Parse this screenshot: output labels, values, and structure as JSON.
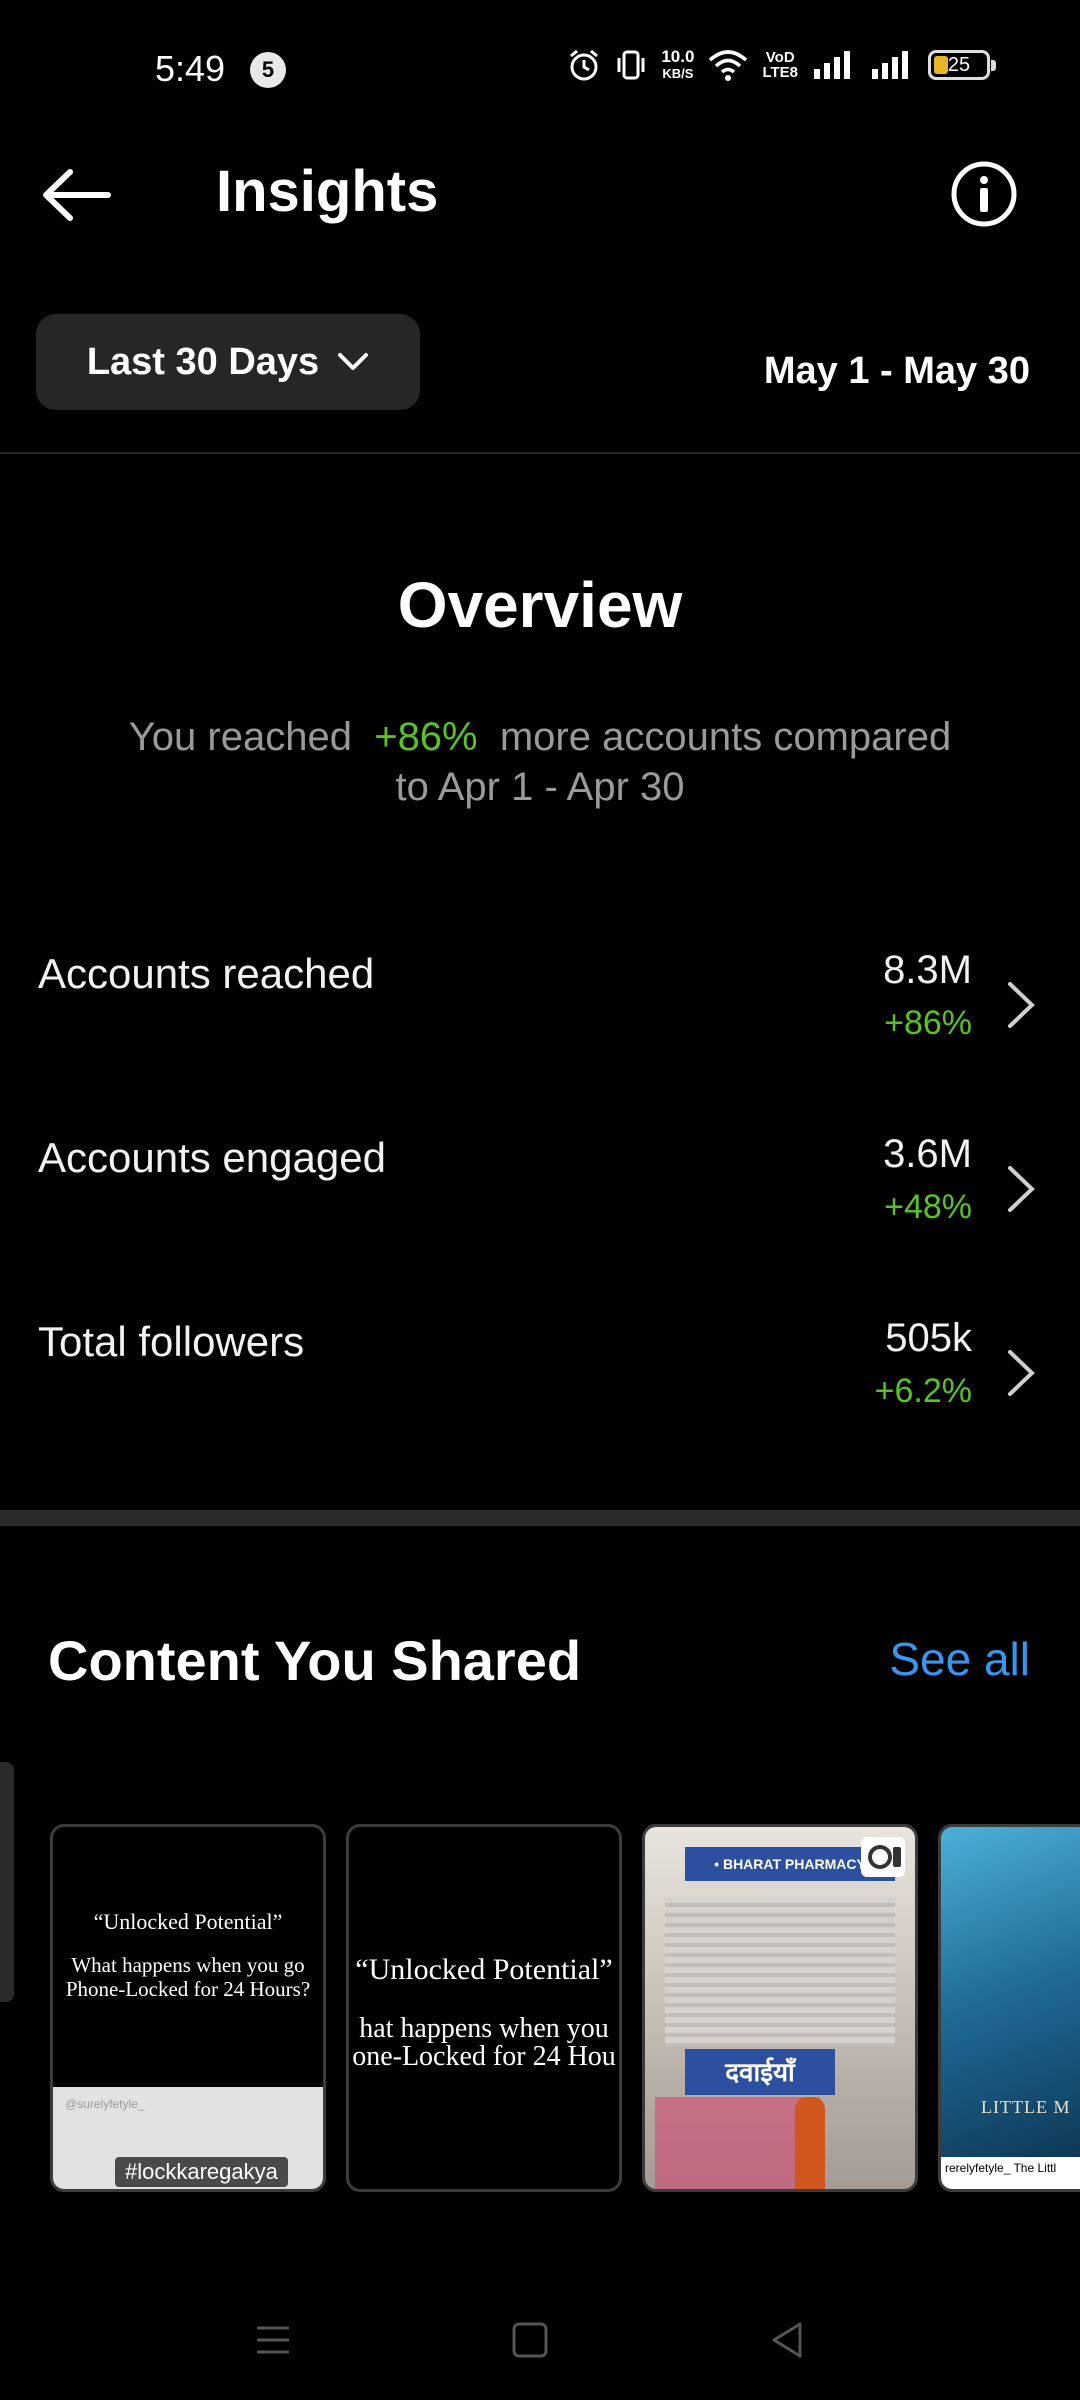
{
  "status_bar": {
    "time": "5:49",
    "notification_count": "5",
    "net_speed_value": "10.0",
    "net_speed_unit": "KB/S",
    "volte_top": "VoD",
    "volte_bottom": "LTE8",
    "battery_level": "25"
  },
  "header": {
    "title": "Insights"
  },
  "filter": {
    "range_label": "Last 30 Days",
    "date_range": "May 1 - May 30"
  },
  "overview": {
    "title": "Overview",
    "desc_prefix": "You reached",
    "desc_change": "+86%",
    "desc_suffix": "more accounts compared",
    "desc_line2": "to Apr 1 - Apr 30"
  },
  "metrics": [
    {
      "label": "Accounts reached",
      "value": "8.3M",
      "change": "+86%"
    },
    {
      "label": "Accounts engaged",
      "value": "3.6M",
      "change": "+48%"
    },
    {
      "label": "Total followers",
      "value": "505k",
      "change": "+6.2%"
    }
  ],
  "content": {
    "title": "Content You Shared",
    "see_all": "See all",
    "thumbs": [
      {
        "quote_title": "“Unlocked Potential”",
        "quote_body": "What happens when you go Phone-Locked for 24 Hours?",
        "handle": "@surelyfetyle_",
        "hashtag": "#lockkaregakya"
      },
      {
        "quote_title": "“Unlocked Potential”",
        "quote_line1": "hat happens when you",
        "quote_line2": "one-Locked for 24 Hou"
      },
      {
        "sign": "• BHARAT PHARMACY",
        "sign2": "दवाईयाँ"
      },
      {
        "poster_title": "LITTLE M",
        "caption": "rerelyfetyle_ The Littl"
      }
    ]
  },
  "colors": {
    "background": "#000000",
    "positive": "#58c322",
    "link": "#3797f0",
    "button_bg": "#262626"
  }
}
